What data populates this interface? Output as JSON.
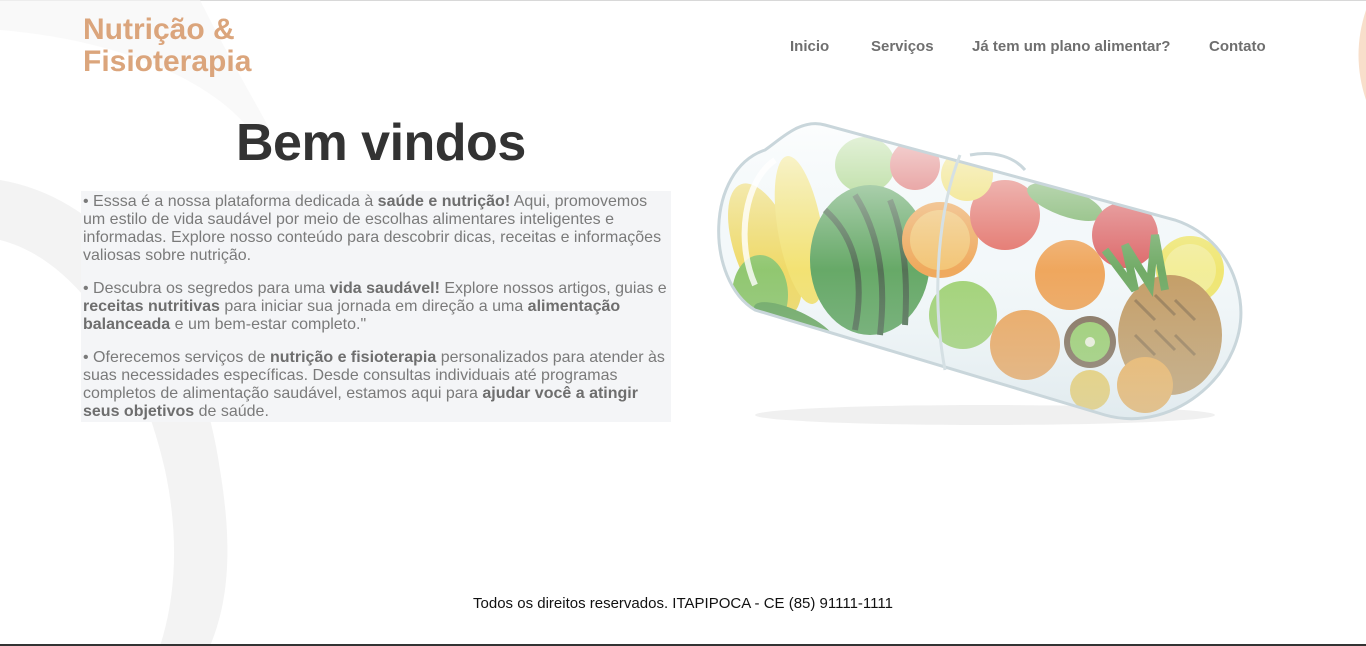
{
  "brand": {
    "line1": "Nutrição &",
    "line2": "Fisioterapia",
    "color": "#dba57c"
  },
  "nav": {
    "items": [
      {
        "label": "Inicio"
      },
      {
        "label": "Serviços"
      },
      {
        "label": "Já tem um plano alimentar?"
      },
      {
        "label": "Contato"
      }
    ]
  },
  "hero": {
    "title": "Bem vindos",
    "paragraphs": [
      [
        {
          "t": "• Esssa é a nossa plataforma dedicada à ",
          "b": false
        },
        {
          "t": "saúde e nutrição!",
          "b": true
        },
        {
          "t": " Aqui, promovemos um estilo de vida saudável por meio de escolhas alimentares inteligentes e informadas. Explore nosso conteúdo para descobrir dicas, receitas e informações valiosas sobre nutrição.",
          "b": false
        }
      ],
      [
        {
          "t": "• Descubra os segredos para uma ",
          "b": false
        },
        {
          "t": "vida saudável!",
          "b": true
        },
        {
          "t": " Explore nossos artigos, guias e ",
          "b": false
        },
        {
          "t": "receitas nutritivas",
          "b": true
        },
        {
          "t": " para iniciar sua jornada em direção a uma ",
          "b": false
        },
        {
          "t": "alimentação balanceada",
          "b": true
        },
        {
          "t": " e um bem-estar completo.\"",
          "b": false
        }
      ],
      [
        {
          "t": "• Oferecemos serviços de ",
          "b": false
        },
        {
          "t": "nutrição e fisioterapia",
          "b": true
        },
        {
          "t": " personalizados para atender às suas necessidades específicas. Desde consultas individuais até programas completos de alimentação saudável, estamos aqui para ",
          "b": false
        },
        {
          "t": "ajudar você a atingir seus objetivos",
          "b": true
        },
        {
          "t": " de saúde.",
          "b": false
        }
      ]
    ],
    "image": {
      "icon": "capsule-with-fruits-image"
    }
  },
  "footer": {
    "text": "Todos os direitos reservados. ITAPIPOCA - CE (85) 91111-1111"
  },
  "colors": {
    "accent": "#dba57c",
    "text": "#7a7a7a",
    "title": "#333333",
    "box": "#f4f5f7"
  }
}
